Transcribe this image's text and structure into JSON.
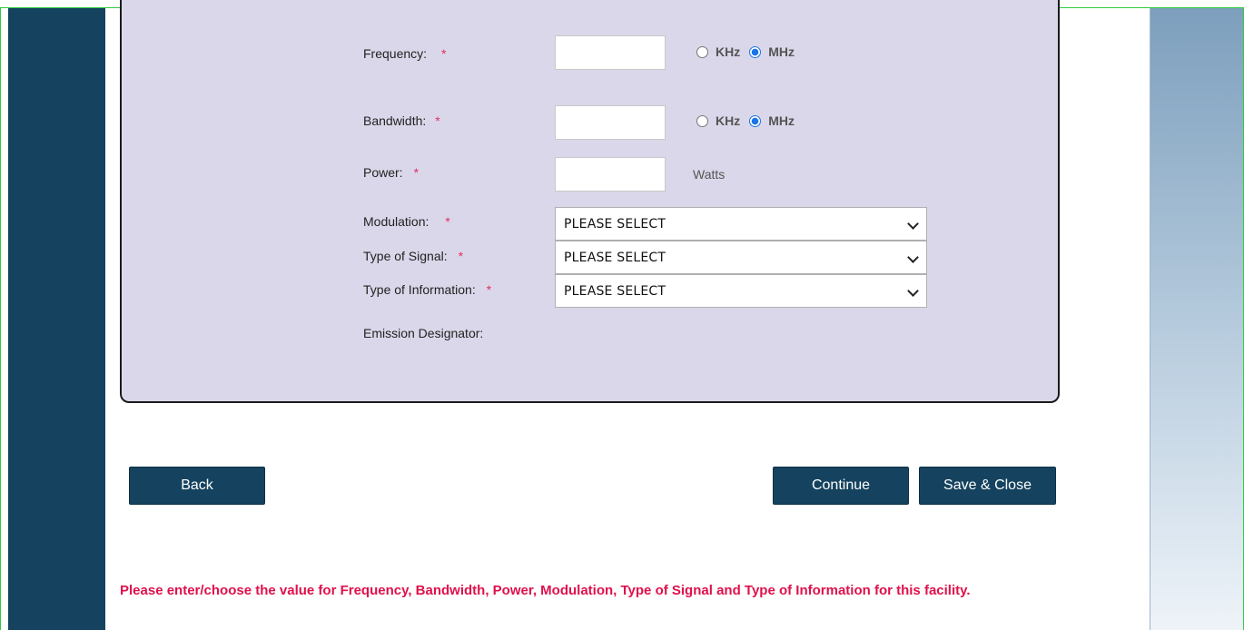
{
  "form": {
    "frequency": {
      "label": "Frequency:",
      "required": "*",
      "value": "",
      "units": [
        "KHz",
        "MHz"
      ],
      "selected_unit": "MHz"
    },
    "bandwidth": {
      "label": "Bandwidth:",
      "required": "*",
      "value": "",
      "units": [
        "KHz",
        "MHz"
      ],
      "selected_unit": "MHz"
    },
    "power": {
      "label": "Power:",
      "required": "*",
      "value": "",
      "unit": "Watts"
    },
    "modulation": {
      "label": "Modulation:",
      "required": "*",
      "selected": "PLEASE SELECT"
    },
    "type_of_signal": {
      "label": "Type of Signal:",
      "required": "*",
      "selected": "PLEASE SELECT"
    },
    "type_of_information": {
      "label": "Type of Information:",
      "required": "*",
      "selected": "PLEASE SELECT"
    },
    "emission_designator": {
      "label": "Emission Designator:"
    }
  },
  "buttons": {
    "back": "Back",
    "continue": "Continue",
    "save_close": "Save & Close"
  },
  "message": "Please enter/choose the value for Frequency, Bandwidth, Power, Modulation, Type of Signal and Type of Information for this facility.",
  "colors": {
    "sidebar": "#15435f",
    "panel": "#dbd7ea",
    "error": "#e0104a",
    "accent": "#1a73e8"
  }
}
